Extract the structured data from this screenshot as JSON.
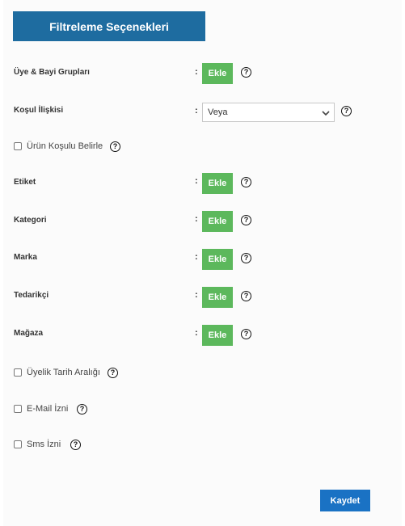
{
  "header": {
    "title": "Filtreleme Seçenekleri"
  },
  "fields": {
    "uye_bayi": {
      "label": "Üye & Bayi Grupları",
      "button": "Ekle"
    },
    "kosul": {
      "label": "Koşul İlişkisi",
      "selected": "Veya"
    },
    "urun_kosulu": {
      "label": "Ürün Koşulu Belirle",
      "checked": false
    },
    "etiket": {
      "label": "Etiket",
      "button": "Ekle"
    },
    "kategori": {
      "label": "Kategori",
      "button": "Ekle"
    },
    "marka": {
      "label": "Marka",
      "button": "Ekle"
    },
    "tedarikci": {
      "label": "Tedarikçi",
      "button": "Ekle"
    },
    "magaza": {
      "label": "Mağaza",
      "button": "Ekle"
    },
    "uyelik_tarih": {
      "label": "Üyelik Tarih Aralığı",
      "checked": false
    },
    "email_izni": {
      "label": "E-Mail İzni",
      "checked": false
    },
    "sms_izni": {
      "label": "Sms İzni",
      "checked": false
    }
  },
  "colon": ":",
  "help_glyph": "?",
  "footer": {
    "save_label": "Kaydet"
  },
  "colors": {
    "header": "#1e6ca0",
    "add": "#5cb85c",
    "save": "#1a72c4"
  },
  "icons": {
    "help": "help-circle-icon",
    "dropdown": "chevron-down-icon"
  }
}
